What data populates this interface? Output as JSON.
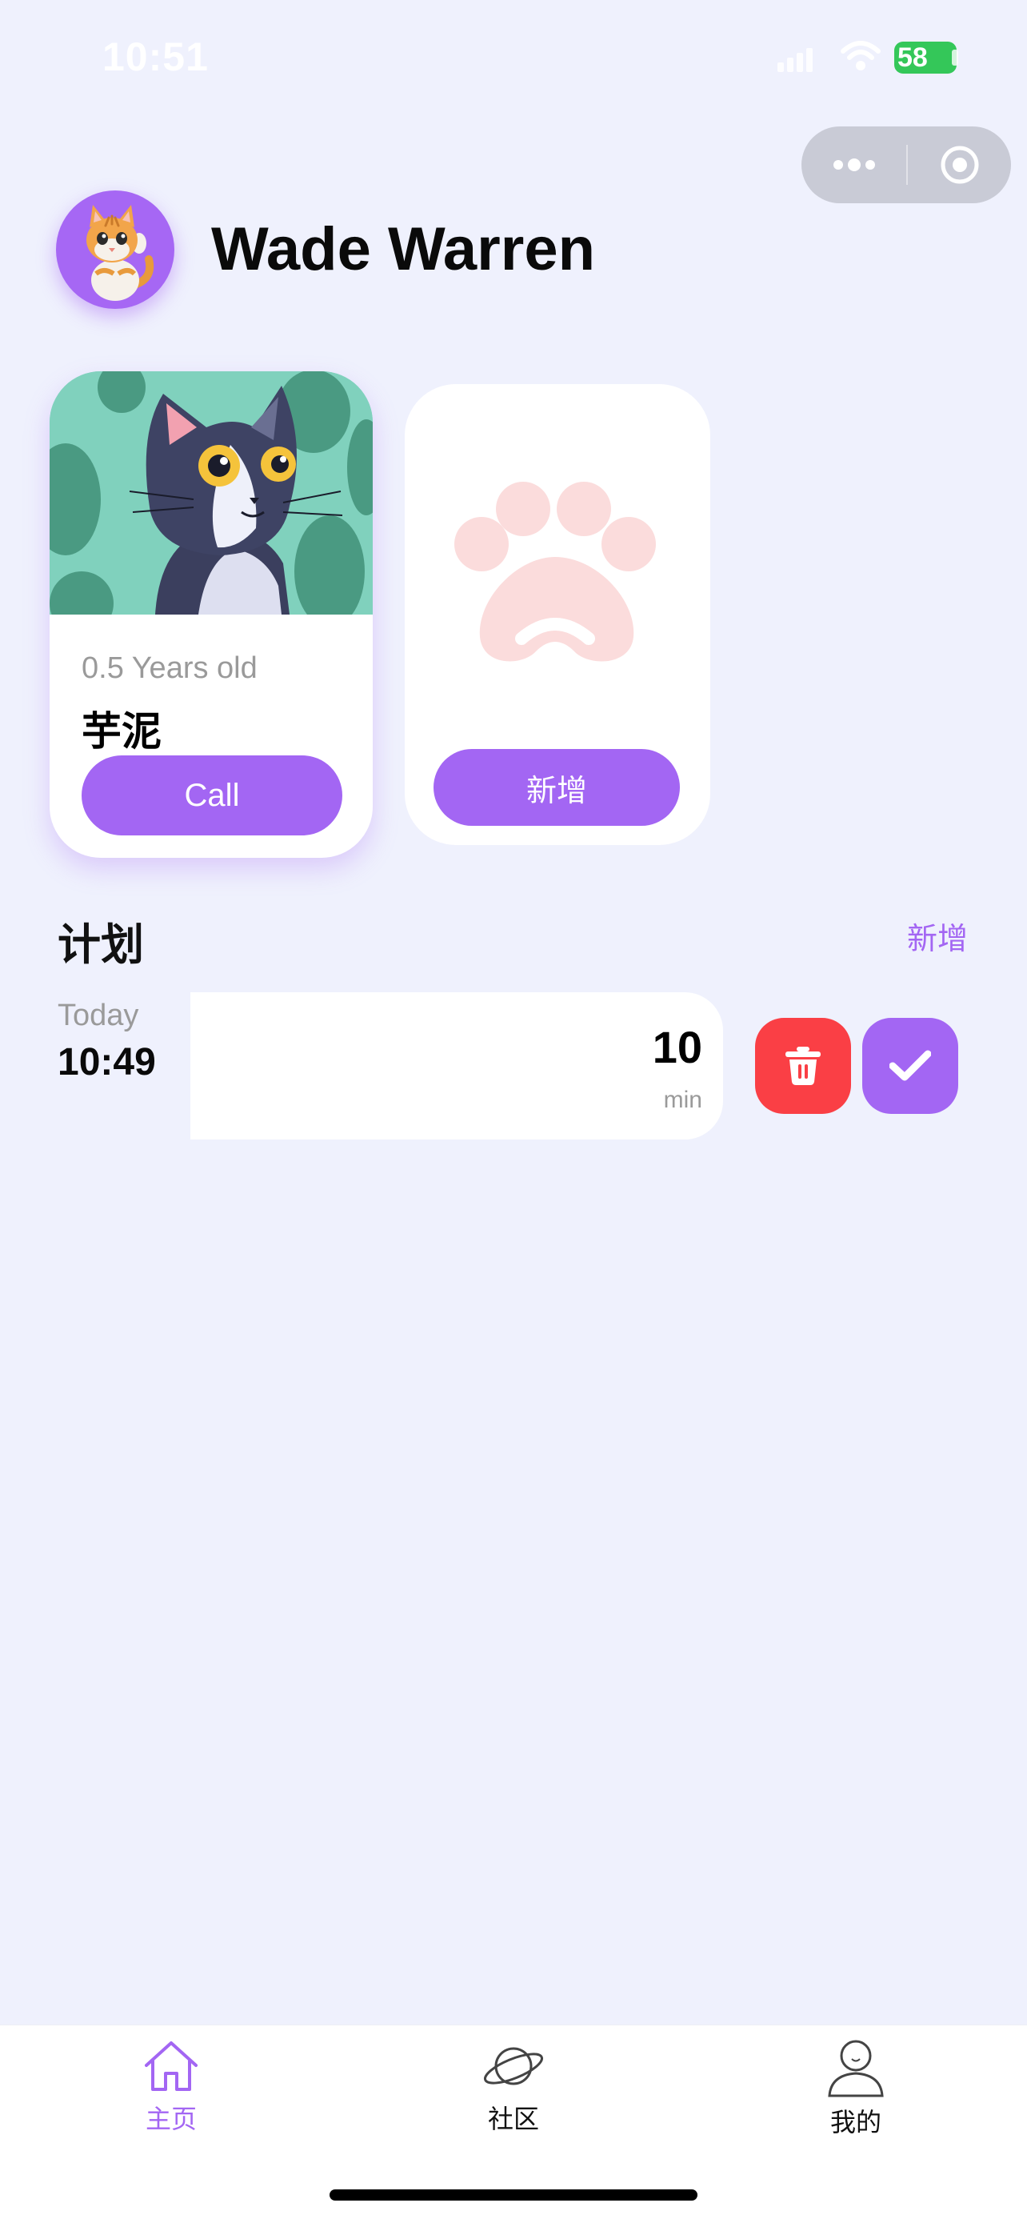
{
  "status_bar": {
    "time": "10:51",
    "battery": "58",
    "icons": [
      "signal-icon",
      "wifi-icon",
      "battery-icon"
    ]
  },
  "capsule": {
    "icons": [
      "more-dots-icon",
      "close-target-icon"
    ]
  },
  "header": {
    "user_name": "Wade Warren",
    "avatar_icon": "kitten-avatar"
  },
  "pets": [
    {
      "age": "0.5 Years old",
      "name": "芋泥",
      "call_label": "Call",
      "photo": "cartoon-cat-photo"
    }
  ],
  "add_pet": {
    "label": "新增",
    "icon": "paw-icon"
  },
  "plan": {
    "title": "计划",
    "add_label": "新增",
    "items": [
      {
        "day": "Today",
        "time": "10:49",
        "duration": "10",
        "unit": "min"
      }
    ]
  },
  "tabs": [
    {
      "label": "主页",
      "icon": "home-icon",
      "active": true
    },
    {
      "label": "社区",
      "icon": "planet-icon",
      "active": false
    },
    {
      "label": "我的",
      "icon": "person-icon",
      "active": false
    }
  ],
  "colors": {
    "accent": "#a366f3",
    "danger": "#fa3f45",
    "background": "#eff1fd"
  }
}
